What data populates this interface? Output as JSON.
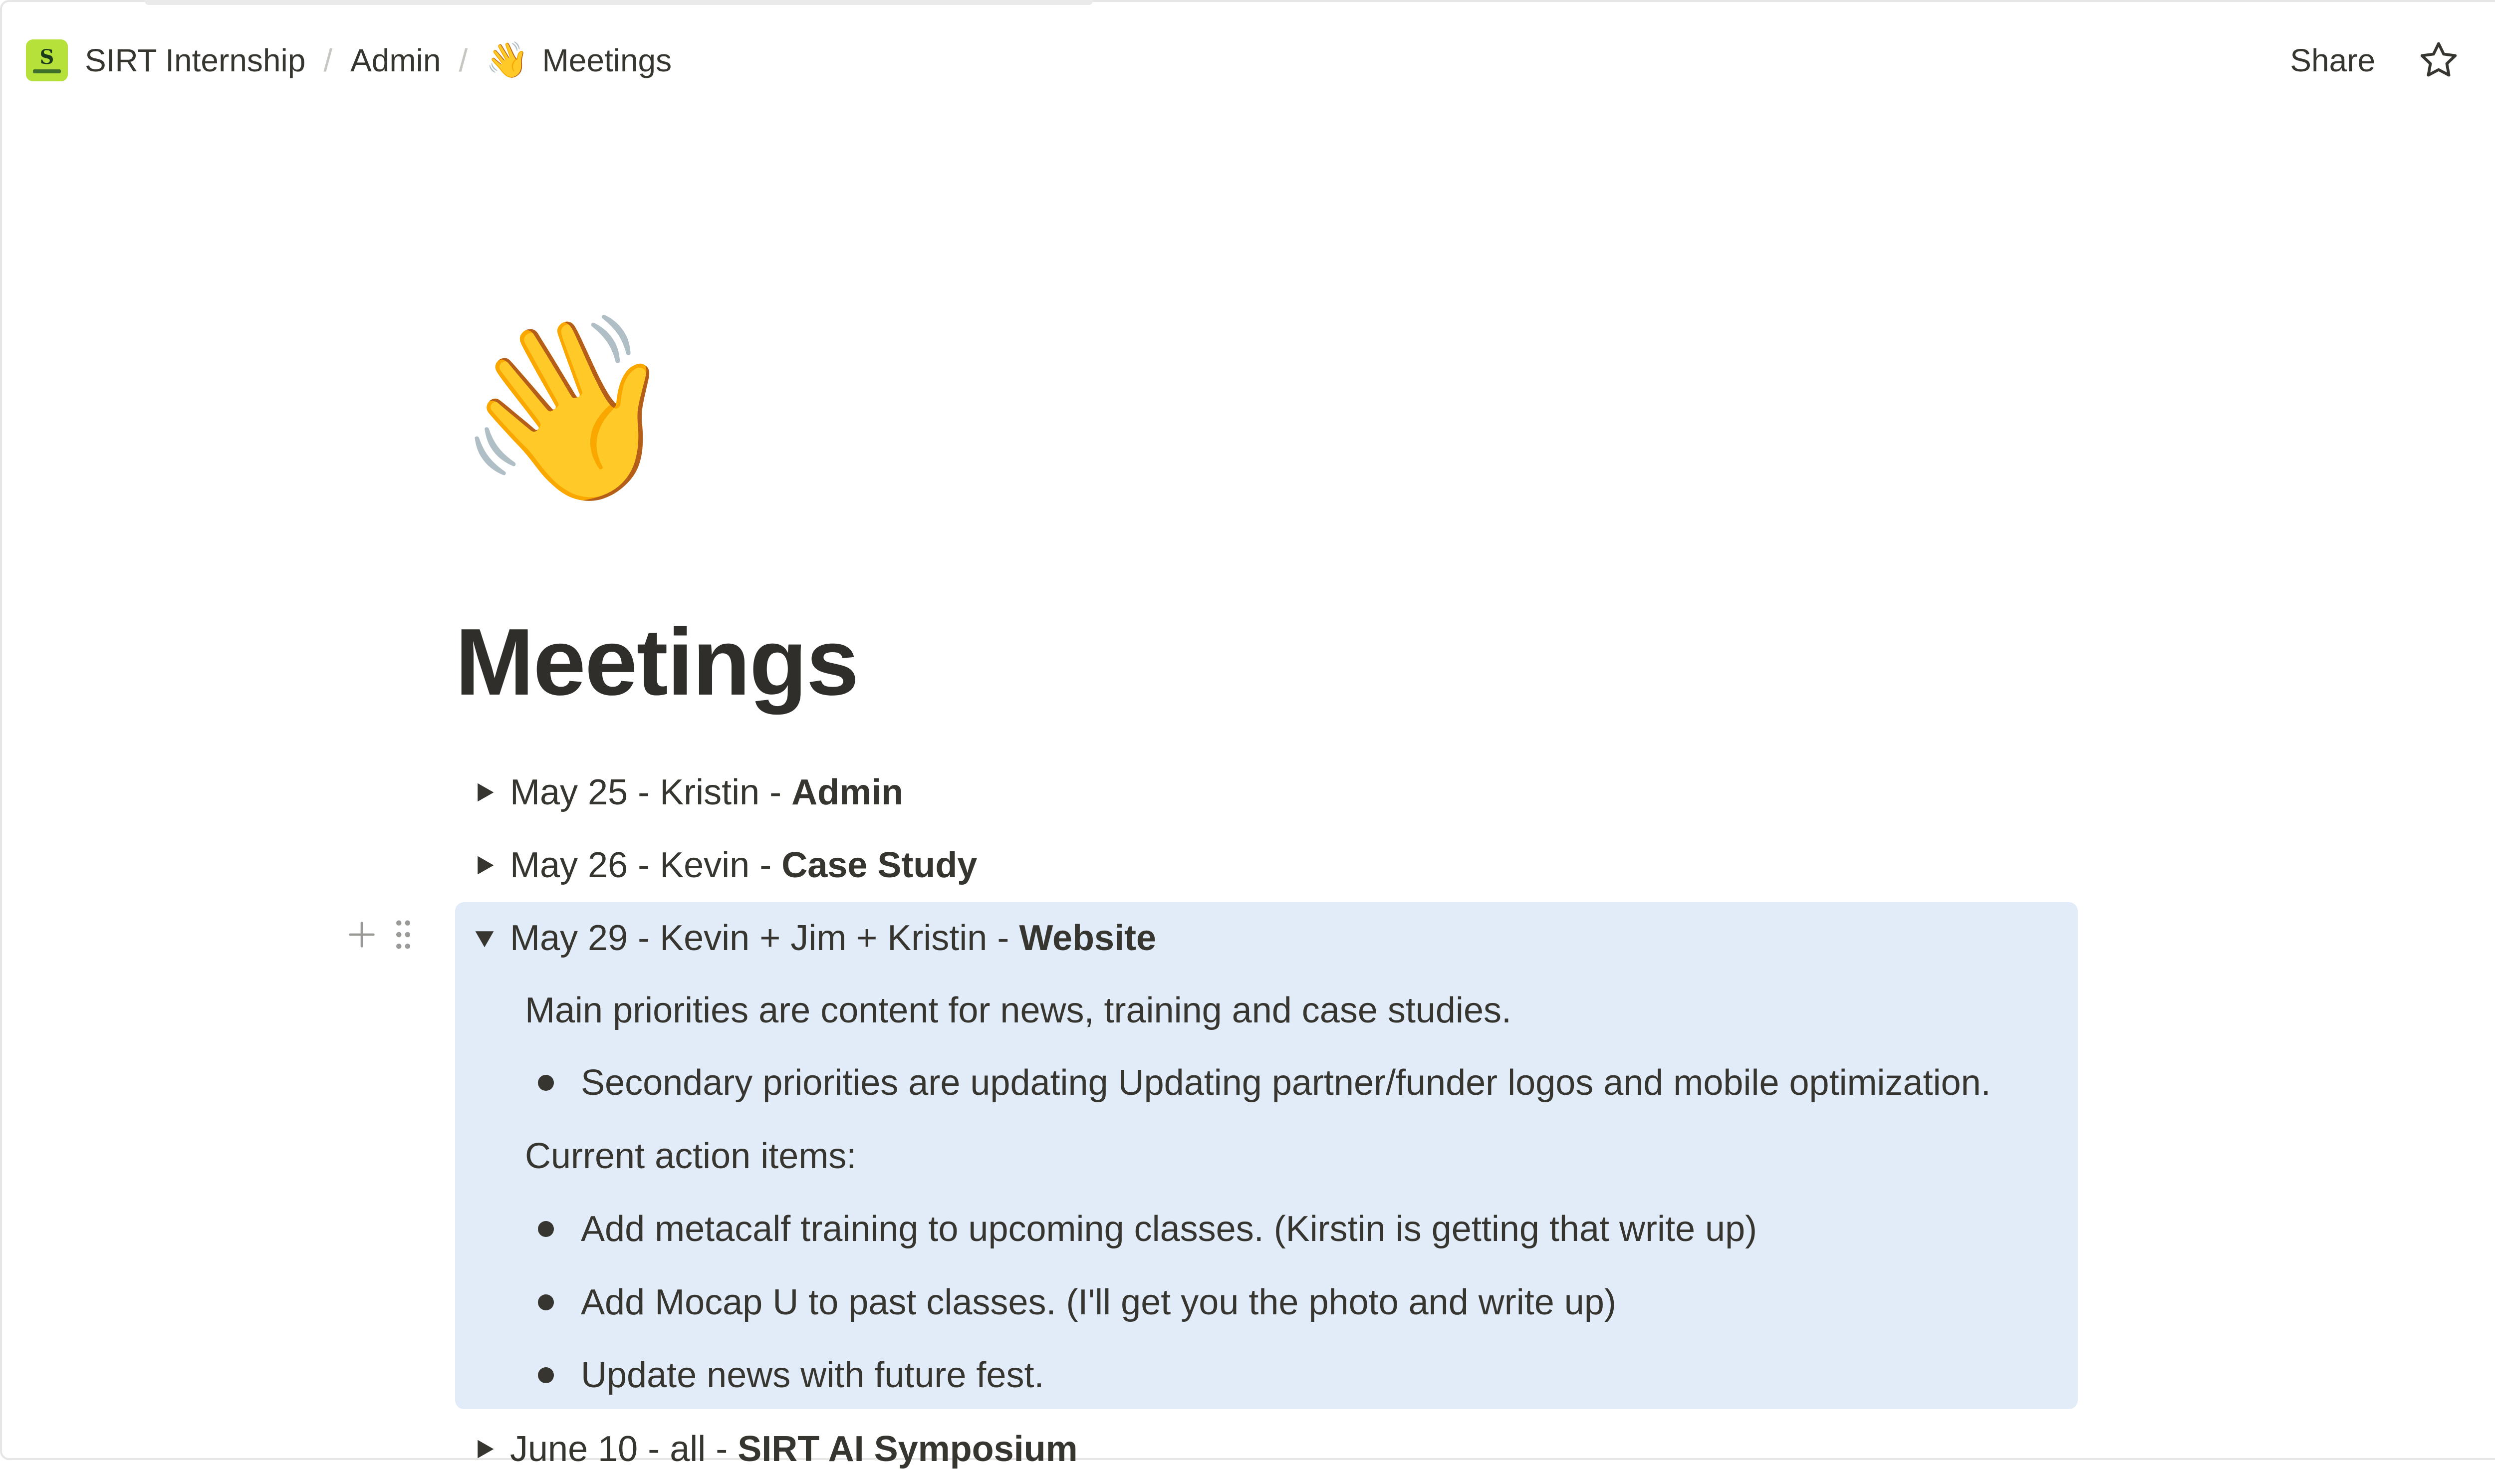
{
  "breadcrumb": {
    "workspace": "SIRT Internship",
    "workspace_logo_letter": "S",
    "parent": "Admin",
    "current_emoji": "👋",
    "current": "Meetings"
  },
  "top_actions": {
    "share_label": "Share",
    "more_label": "···"
  },
  "page": {
    "emoji": "👋",
    "title": "Meetings"
  },
  "meetings": [
    {
      "prefix": "May 25 - Kristin - ",
      "topic": "Admin",
      "expanded": false
    },
    {
      "prefix": "May 26 - Kevin - ",
      "topic": "Case Study",
      "expanded": false
    },
    {
      "prefix": "May 29 - Kevin + Jim + Kristin - ",
      "topic": "Website",
      "expanded": true
    },
    {
      "prefix": "June 10 - all - ",
      "topic": "SIRT AI Symposium",
      "expanded": false
    }
  ],
  "expanded_content": {
    "intro": "Main priorities are content for news, training and case studies.",
    "secondary": "Secondary priorities are updating Updating partner/funder logos and mobile optimization.",
    "action_heading": "Current action items:",
    "action_items": [
      "Add metacalf training to upcoming classes. (Kirstin is getting that write up)",
      "Add Mocap U to past classes. (I'll get you the photo and write up)",
      "Update news with future fest."
    ]
  },
  "colors": {
    "highlight": "#e2ecf9",
    "text": "#37352f",
    "logo_bg": "#b6e03a"
  }
}
